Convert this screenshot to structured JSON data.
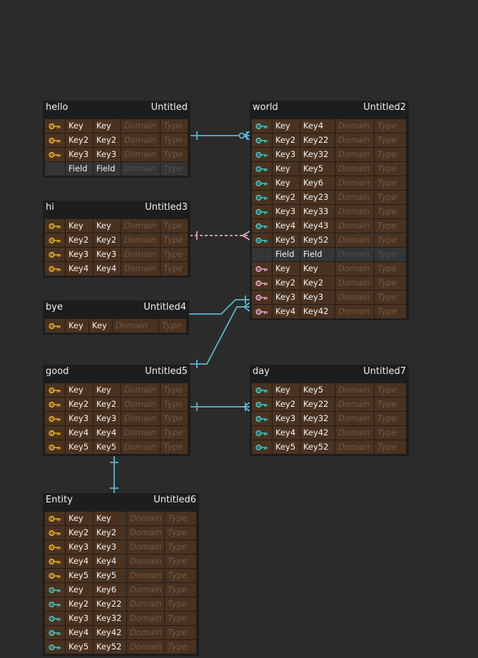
{
  "colors": {
    "background": "#2b2b2b",
    "entity_bg": "#1d1d1d",
    "key_row_bg": "#4a3220",
    "field_row_bg": "#353535",
    "pk_key": "#e8b014",
    "fk_key": "#3ec6c6",
    "ref_key": "#e0a6c0",
    "link_blue": "#5bb6cf",
    "link_pink": "#e6a6c0"
  },
  "entities": [
    {
      "name": "hello",
      "table": "Untitled",
      "rows": [
        {
          "kind": "pk",
          "name": "Key",
          "column": "Key",
          "domain": "Domain",
          "type": "Type"
        },
        {
          "kind": "pk",
          "name": "Key2",
          "column": "Key2",
          "domain": "Domain",
          "type": "Type"
        },
        {
          "kind": "pk",
          "name": "Key3",
          "column": "Key3",
          "domain": "Domain",
          "type": "Type"
        },
        {
          "kind": "field",
          "name": "Field",
          "column": "Field",
          "domain": "Domain",
          "type": "Type"
        }
      ]
    },
    {
      "name": "hi",
      "table": "Untitled3",
      "rows": [
        {
          "kind": "pk",
          "name": "Key",
          "column": "Key",
          "domain": "Domain",
          "type": "Type"
        },
        {
          "kind": "pk",
          "name": "Key2",
          "column": "Key2",
          "domain": "Domain",
          "type": "Type"
        },
        {
          "kind": "pk",
          "name": "Key3",
          "column": "Key3",
          "domain": "Domain",
          "type": "Type"
        },
        {
          "kind": "pk",
          "name": "Key4",
          "column": "Key4",
          "domain": "Domain",
          "type": "Type"
        }
      ]
    },
    {
      "name": "bye",
      "table": "Untitled4",
      "rows": [
        {
          "kind": "pk",
          "name": "Key",
          "column": "Key",
          "domain": "Domain",
          "type": "Type"
        }
      ]
    },
    {
      "name": "good",
      "table": "Untitled5",
      "rows": [
        {
          "kind": "pk",
          "name": "Key",
          "column": "Key",
          "domain": "Domain",
          "type": "Type"
        },
        {
          "kind": "pk",
          "name": "Key2",
          "column": "Key2",
          "domain": "Domain",
          "type": "Type"
        },
        {
          "kind": "pk",
          "name": "Key3",
          "column": "Key3",
          "domain": "Domain",
          "type": "Type"
        },
        {
          "kind": "pk",
          "name": "Key4",
          "column": "Key4",
          "domain": "Domain",
          "type": "Type"
        },
        {
          "kind": "pk",
          "name": "Key5",
          "column": "Key5",
          "domain": "Domain",
          "type": "Type"
        }
      ]
    },
    {
      "name": "Entity",
      "table": "Untitled6",
      "rows": [
        {
          "kind": "pk",
          "name": "Key",
          "column": "Key",
          "domain": "Domain",
          "type": "Type"
        },
        {
          "kind": "pk",
          "name": "Key2",
          "column": "Key2",
          "domain": "Domain",
          "type": "Type"
        },
        {
          "kind": "pk",
          "name": "Key3",
          "column": "Key3",
          "domain": "Domain",
          "type": "Type"
        },
        {
          "kind": "pk",
          "name": "Key4",
          "column": "Key4",
          "domain": "Domain",
          "type": "Type"
        },
        {
          "kind": "pk",
          "name": "Key5",
          "column": "Key5",
          "domain": "Domain",
          "type": "Type"
        },
        {
          "kind": "fk",
          "name": "Key",
          "column": "Key6",
          "domain": "Domain",
          "type": "Type"
        },
        {
          "kind": "fk",
          "name": "Key2",
          "column": "Key22",
          "domain": "Domain",
          "type": "Type"
        },
        {
          "kind": "fk",
          "name": "Key3",
          "column": "Key32",
          "domain": "Domain",
          "type": "Type"
        },
        {
          "kind": "fk",
          "name": "Key4",
          "column": "Key42",
          "domain": "Domain",
          "type": "Type"
        },
        {
          "kind": "fk",
          "name": "Key5",
          "column": "Key52",
          "domain": "Domain",
          "type": "Type"
        }
      ]
    },
    {
      "name": "world",
      "table": "Untitled2",
      "rows": [
        {
          "kind": "fk",
          "name": "Key",
          "column": "Key4",
          "domain": "Domain",
          "type": "Type"
        },
        {
          "kind": "fk",
          "name": "Key2",
          "column": "Key22",
          "domain": "Domain",
          "type": "Type"
        },
        {
          "kind": "fk",
          "name": "Key3",
          "column": "Key32",
          "domain": "Domain",
          "type": "Type"
        },
        {
          "kind": "fk",
          "name": "Key",
          "column": "Key5",
          "domain": "Domain",
          "type": "Type"
        },
        {
          "kind": "fk",
          "name": "Key",
          "column": "Key6",
          "domain": "Domain",
          "type": "Type"
        },
        {
          "kind": "fk",
          "name": "Key2",
          "column": "Key23",
          "domain": "Domain",
          "type": "Type"
        },
        {
          "kind": "fk",
          "name": "Key3",
          "column": "Key33",
          "domain": "Domain",
          "type": "Type"
        },
        {
          "kind": "fk",
          "name": "Key4",
          "column": "Key43",
          "domain": "Domain",
          "type": "Type"
        },
        {
          "kind": "fk",
          "name": "Key5",
          "column": "Key52",
          "domain": "Domain",
          "type": "Type"
        },
        {
          "kind": "field",
          "name": "Field",
          "column": "Field",
          "domain": "Domain",
          "type": "Type"
        },
        {
          "kind": "ref",
          "name": "Key",
          "column": "Key",
          "domain": "Domain",
          "type": "Type"
        },
        {
          "kind": "ref",
          "name": "Key2",
          "column": "Key2",
          "domain": "Domain",
          "type": "Type"
        },
        {
          "kind": "ref",
          "name": "Key3",
          "column": "Key3",
          "domain": "Domain",
          "type": "Type"
        },
        {
          "kind": "ref",
          "name": "Key4",
          "column": "Key42",
          "domain": "Domain",
          "type": "Type"
        }
      ]
    },
    {
      "name": "day",
      "table": "Untitled7",
      "rows": [
        {
          "kind": "fk",
          "name": "Key",
          "column": "Key5",
          "domain": "Domain",
          "type": "Type"
        },
        {
          "kind": "fk",
          "name": "Key2",
          "column": "Key22",
          "domain": "Domain",
          "type": "Type"
        },
        {
          "kind": "fk",
          "name": "Key3",
          "column": "Key32",
          "domain": "Domain",
          "type": "Type"
        },
        {
          "kind": "fk",
          "name": "Key4",
          "column": "Key42",
          "domain": "Domain",
          "type": "Type"
        },
        {
          "kind": "fk",
          "name": "Key5",
          "column": "Key52",
          "domain": "Domain",
          "type": "Type"
        }
      ]
    }
  ],
  "relationships": [
    {
      "from": "hello",
      "to": "world",
      "style": "solid",
      "color": "blue",
      "end": "zero-or-many"
    },
    {
      "from": "hi",
      "to": "world",
      "style": "dashed",
      "color": "pink",
      "end": "many"
    },
    {
      "from": "bye",
      "to": "world",
      "style": "solid",
      "color": "blue",
      "end": "one-or-many"
    },
    {
      "from": "good",
      "to": "world",
      "style": "solid",
      "color": "blue",
      "end": "one-or-many"
    },
    {
      "from": "good",
      "to": "day",
      "style": "solid",
      "color": "blue",
      "end": "one-or-many"
    },
    {
      "from": "good",
      "to": "Entity",
      "style": "solid",
      "color": "blue",
      "end": "one"
    }
  ]
}
